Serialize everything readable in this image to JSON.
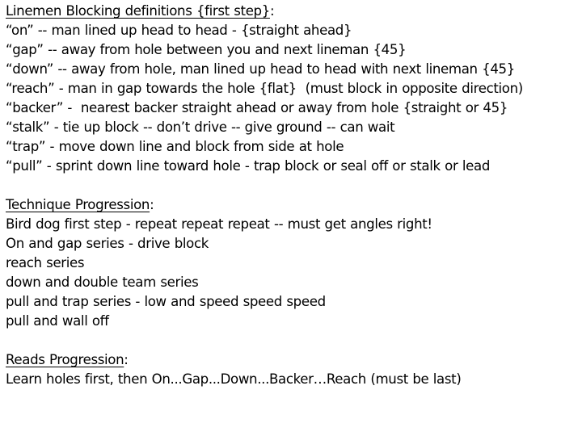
{
  "sections": [
    {
      "heading": "Linemen Blocking definitions {first step}",
      "heading_suffix": ":",
      "lines": [
        "“on” -- man lined up head to head - {straight ahead}",
        "“gap” -- away from hole between you and next lineman {45}",
        "“down” -- away from hole, man lined up head to head with next lineman {45}",
        "“reach” - man in gap towards the hole {flat}  (must block in opposite direction)",
        "“backer” -  nearest backer straight ahead or away from hole {straight or 45}",
        "“stalk” - tie up block -- don’t drive -- give ground -- can wait",
        "“trap” - move down line and block from side at hole",
        "“pull” - sprint down line toward hole - trap block or seal off or stalk or lead"
      ]
    },
    {
      "heading": "Technique Progression",
      "heading_suffix": ":",
      "lines": [
        "Bird dog first step - repeat repeat repeat -- must get angles right!",
        "On and gap series - drive block",
        "reach series",
        "down and double team series",
        "pull and trap series - low and speed speed speed",
        "pull and wall off"
      ]
    },
    {
      "heading": "Reads Progression",
      "heading_suffix": ":",
      "lines": [
        "Learn holes first, then On...Gap...Down...Backer…Reach (must be last)"
      ]
    }
  ]
}
